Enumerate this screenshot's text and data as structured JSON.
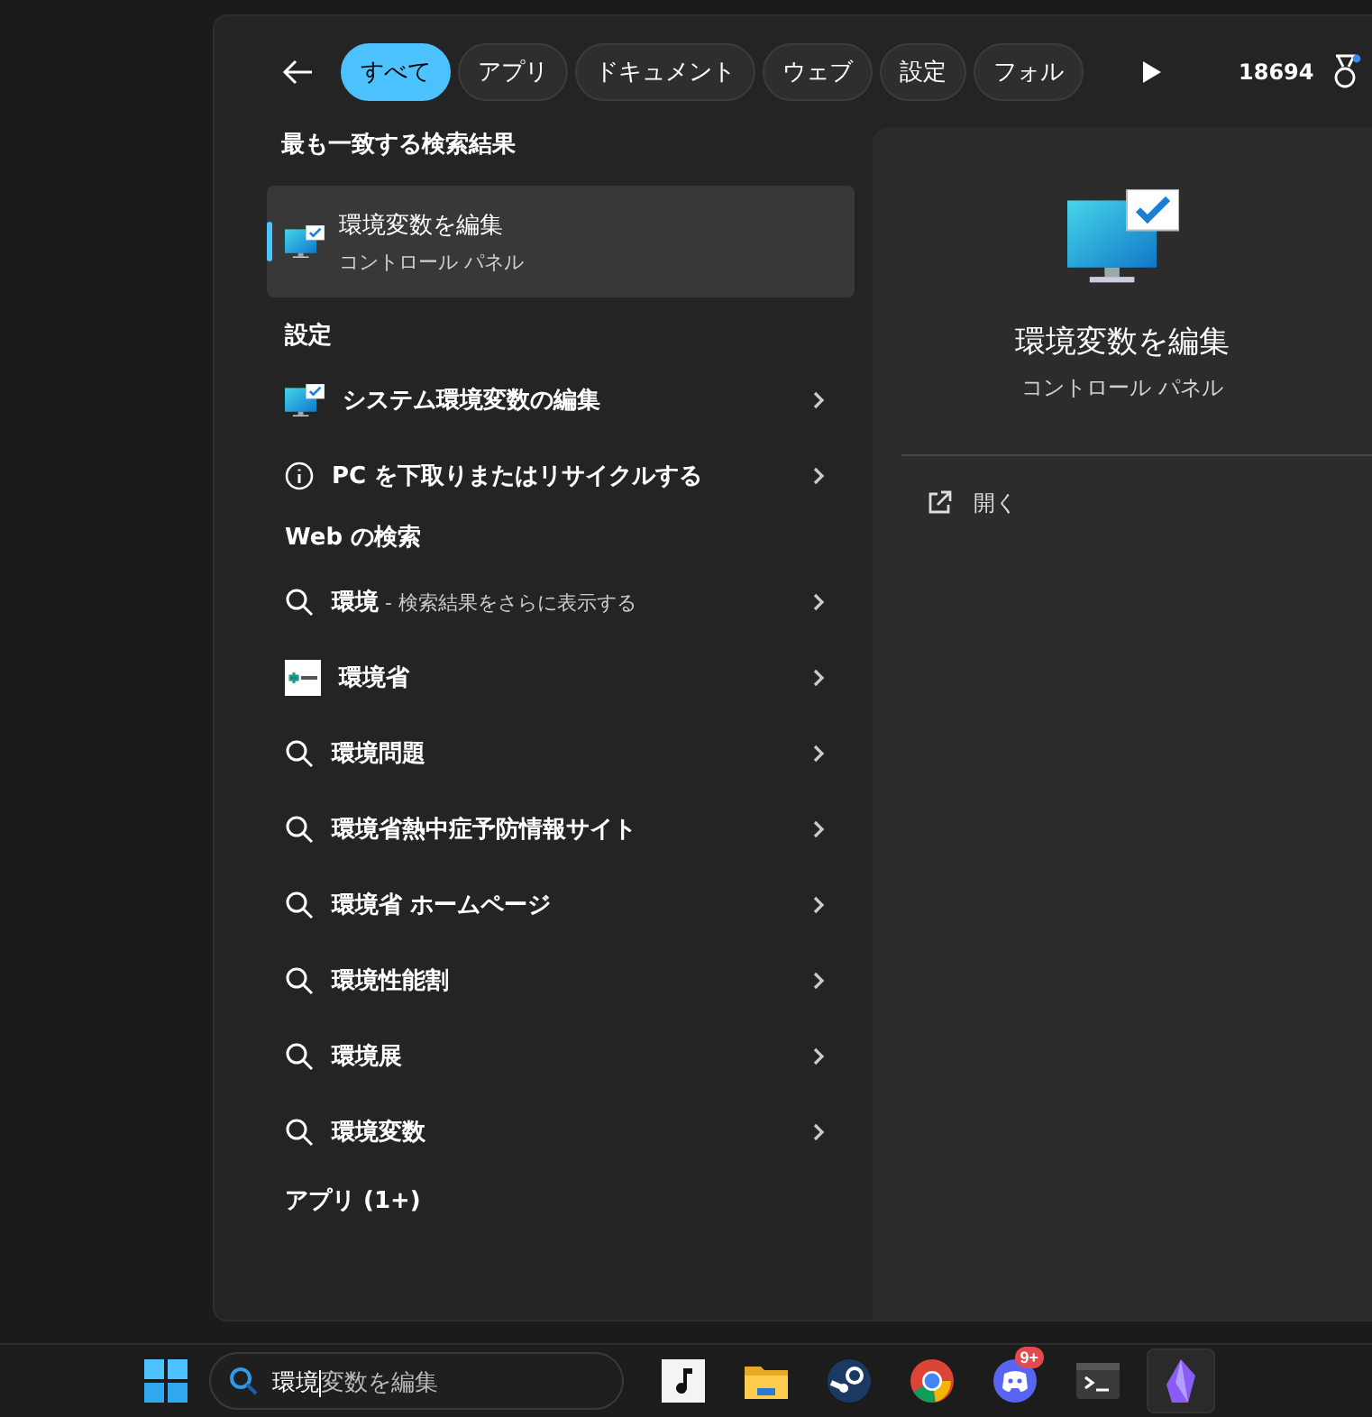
{
  "filters": [
    {
      "label": "すべて",
      "selected": true
    },
    {
      "label": "アプリ",
      "selected": false
    },
    {
      "label": "ドキュメント",
      "selected": false
    },
    {
      "label": "ウェブ",
      "selected": false
    },
    {
      "label": "設定",
      "selected": false
    },
    {
      "label": "フォル",
      "selected": false
    }
  ],
  "points": "18694",
  "best_match": {
    "heading": "最も一致する検索結果",
    "title": "環境変数を編集",
    "subtitle": "コントロール パネル",
    "selected": true
  },
  "settings": {
    "heading": "設定",
    "items": [
      {
        "kind": "monitor",
        "label": "システム環境変数の編集"
      },
      {
        "kind": "info",
        "label": "PC を下取りまたはリサイクルする"
      }
    ]
  },
  "web": {
    "heading": "Web の検索",
    "items": [
      {
        "kind": "search",
        "label": "環境",
        "hint": " - 検索結果をさらに表示する"
      },
      {
        "kind": "site",
        "label": "環境省"
      },
      {
        "kind": "search",
        "label": "環境問題"
      },
      {
        "kind": "search",
        "label": "環境省熱中症予防情報サイト"
      },
      {
        "kind": "search",
        "label": "環境省 ホームページ"
      },
      {
        "kind": "search",
        "label": "環境性能割"
      },
      {
        "kind": "search",
        "label": "環境展"
      },
      {
        "kind": "search",
        "label": "環境変数"
      }
    ]
  },
  "apps_heading": "アプリ (1+)",
  "preview": {
    "title": "環境変数を編集",
    "subtitle": "コントロール パネル",
    "actions": [
      "開く"
    ]
  },
  "taskbar": {
    "search": {
      "value": "環境",
      "suggestion": "変数を編集"
    },
    "apps": [
      {
        "kind": "music",
        "selected": false
      },
      {
        "kind": "folder",
        "selected": false
      },
      {
        "kind": "steam",
        "selected": false
      },
      {
        "kind": "browser",
        "selected": false
      },
      {
        "kind": "chat",
        "selected": false,
        "badge": "9+"
      },
      {
        "kind": "terminal",
        "selected": false
      },
      {
        "kind": "crystal",
        "selected": true
      }
    ]
  }
}
